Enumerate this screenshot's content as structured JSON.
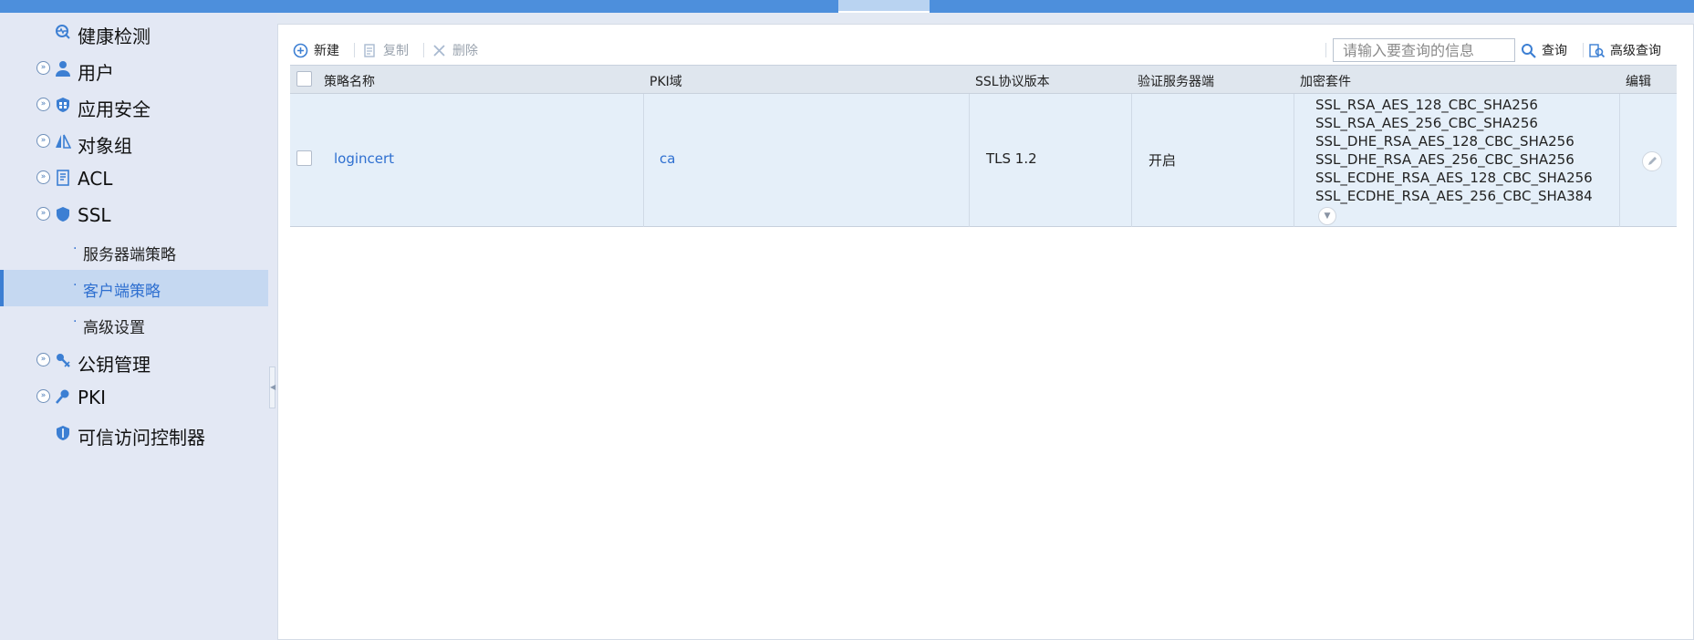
{
  "colors": {
    "topbar": "#4d8fdc",
    "sidebar_bg": "#e3e8f4",
    "active_bg": "#c5d8f1",
    "accent": "#2e6fd0",
    "row_bg": "#e5eff9",
    "header_bg": "#dfe6ee"
  },
  "sidebar": {
    "items": [
      {
        "label": "健康检测",
        "icon": "heartbeat-icon",
        "expander": false
      },
      {
        "label": "用户",
        "icon": "user-icon",
        "expander": true
      },
      {
        "label": "应用安全",
        "icon": "app-shield-icon",
        "expander": true
      },
      {
        "label": "对象组",
        "icon": "object-group-icon",
        "expander": true
      },
      {
        "label": "ACL",
        "icon": "acl-doc-icon",
        "expander": true
      },
      {
        "label": "SSL",
        "icon": "shield-icon",
        "expander": true,
        "expanded": true
      },
      {
        "label": "公钥管理",
        "icon": "key-tools-icon",
        "expander": true
      },
      {
        "label": "PKI",
        "icon": "key-icon",
        "expander": true
      },
      {
        "label": "可信访问控制器",
        "icon": "trust-shield-icon",
        "expander": false
      }
    ],
    "ssl_sub": [
      {
        "label": "服务器端策略",
        "active": false
      },
      {
        "label": "客户端策略",
        "active": true
      },
      {
        "label": "高级设置",
        "active": false
      }
    ]
  },
  "toolbar": {
    "new_label": "新建",
    "copy_label": "复制",
    "delete_label": "删除",
    "search_placeholder": "请输入要查询的信息",
    "query_label": "查询",
    "advanced_query_label": "高级查询"
  },
  "table": {
    "columns": [
      "策略名称",
      "PKI域",
      "SSL协议版本",
      "验证服务器端",
      "加密套件",
      "编辑"
    ],
    "rows": [
      {
        "name": "logincert",
        "pki": "ca",
        "ssl_version": "TLS 1.2",
        "verify_server": "开启",
        "ciphers": [
          "SSL_RSA_AES_128_CBC_SHA256",
          "SSL_RSA_AES_256_CBC_SHA256",
          "SSL_DHE_RSA_AES_128_CBC_SHA256",
          "SSL_DHE_RSA_AES_256_CBC_SHA256",
          "SSL_ECDHE_RSA_AES_128_CBC_SHA256",
          "SSL_ECDHE_RSA_AES_256_CBC_SHA384"
        ]
      }
    ]
  }
}
